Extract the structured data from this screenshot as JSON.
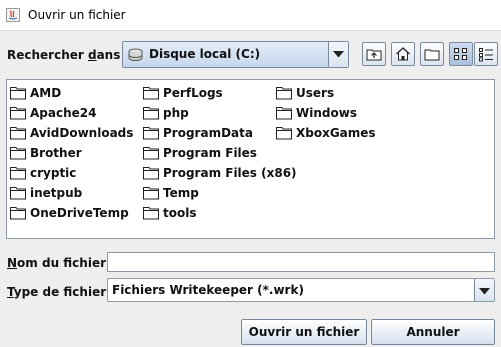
{
  "window": {
    "title": "Ouvrir un fichier"
  },
  "lookin": {
    "label_prefix": "Rechercher ",
    "label_mnemonic": "d",
    "label_suffix": "ans :",
    "selected": "Disque local (C:)"
  },
  "toolbar": {
    "icons": [
      "up-folder-icon",
      "home-icon",
      "new-folder-icon",
      "list-view-icon",
      "details-view-icon"
    ]
  },
  "files": {
    "col1": [
      "AMD",
      "Apache24",
      "AvidDownloads",
      "Brother",
      "cryptic",
      "inetpub",
      "OneDriveTemp"
    ],
    "col2": [
      "PerfLogs",
      "php",
      "ProgramData",
      "Program Files",
      "Program Files (x86)",
      "Temp",
      "tools"
    ],
    "col3": [
      "Users",
      "Windows",
      "XboxGames"
    ]
  },
  "filename": {
    "label_mnemonic": "N",
    "label_rest": "om du fichier :",
    "value": ""
  },
  "filetype": {
    "label_mnemonic": "T",
    "label_rest": "ype de fichier :",
    "selected": "Fichiers Writekeeper (*.wrk)"
  },
  "buttons": {
    "open": "Ouvrir un fichier",
    "cancel": "Annuler"
  }
}
